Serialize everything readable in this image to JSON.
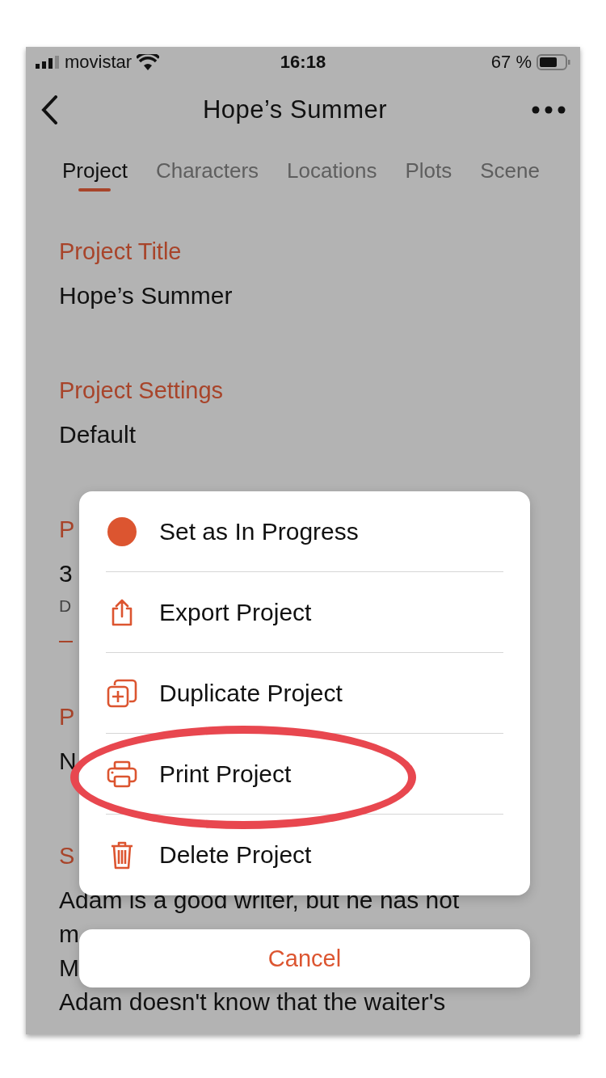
{
  "status_bar": {
    "carrier": "movistar",
    "time": "16:18",
    "battery": "67 %"
  },
  "nav": {
    "title": "Hope’s Summer"
  },
  "tabs": [
    {
      "label": "Project",
      "selected": true
    },
    {
      "label": "Characters",
      "selected": false
    },
    {
      "label": "Locations",
      "selected": false
    },
    {
      "label": "Plots",
      "selected": false
    },
    {
      "label": "Scene",
      "selected": false
    }
  ],
  "sections": [
    {
      "kind": "field",
      "label": "Project Title",
      "value": "Hope’s Summer"
    },
    {
      "kind": "field",
      "label": "Project Settings",
      "value": "Default"
    },
    {
      "kind": "date",
      "label": "P",
      "value": "3",
      "note": "D"
    },
    {
      "kind": "field",
      "label": "P",
      "value": "N"
    },
    {
      "kind": "text",
      "label": "S",
      "lines": [
        "Adam is a good writer, but he has not",
        "m",
        "M",
        "Adam doesn't know that the waiter's"
      ]
    }
  ],
  "menu": {
    "items": [
      {
        "kind": "status",
        "label": "Set as In Progress",
        "color": "#dc5530",
        "circled": false
      },
      {
        "kind": "export",
        "label": "Export Project",
        "circled": false
      },
      {
        "kind": "duplicate",
        "label": "Duplicate Project",
        "circled": false
      },
      {
        "kind": "print",
        "label": "Print Project",
        "circled": true
      },
      {
        "kind": "delete",
        "label": "Delete Project",
        "circled": false
      }
    ],
    "cancel": "Cancel"
  }
}
